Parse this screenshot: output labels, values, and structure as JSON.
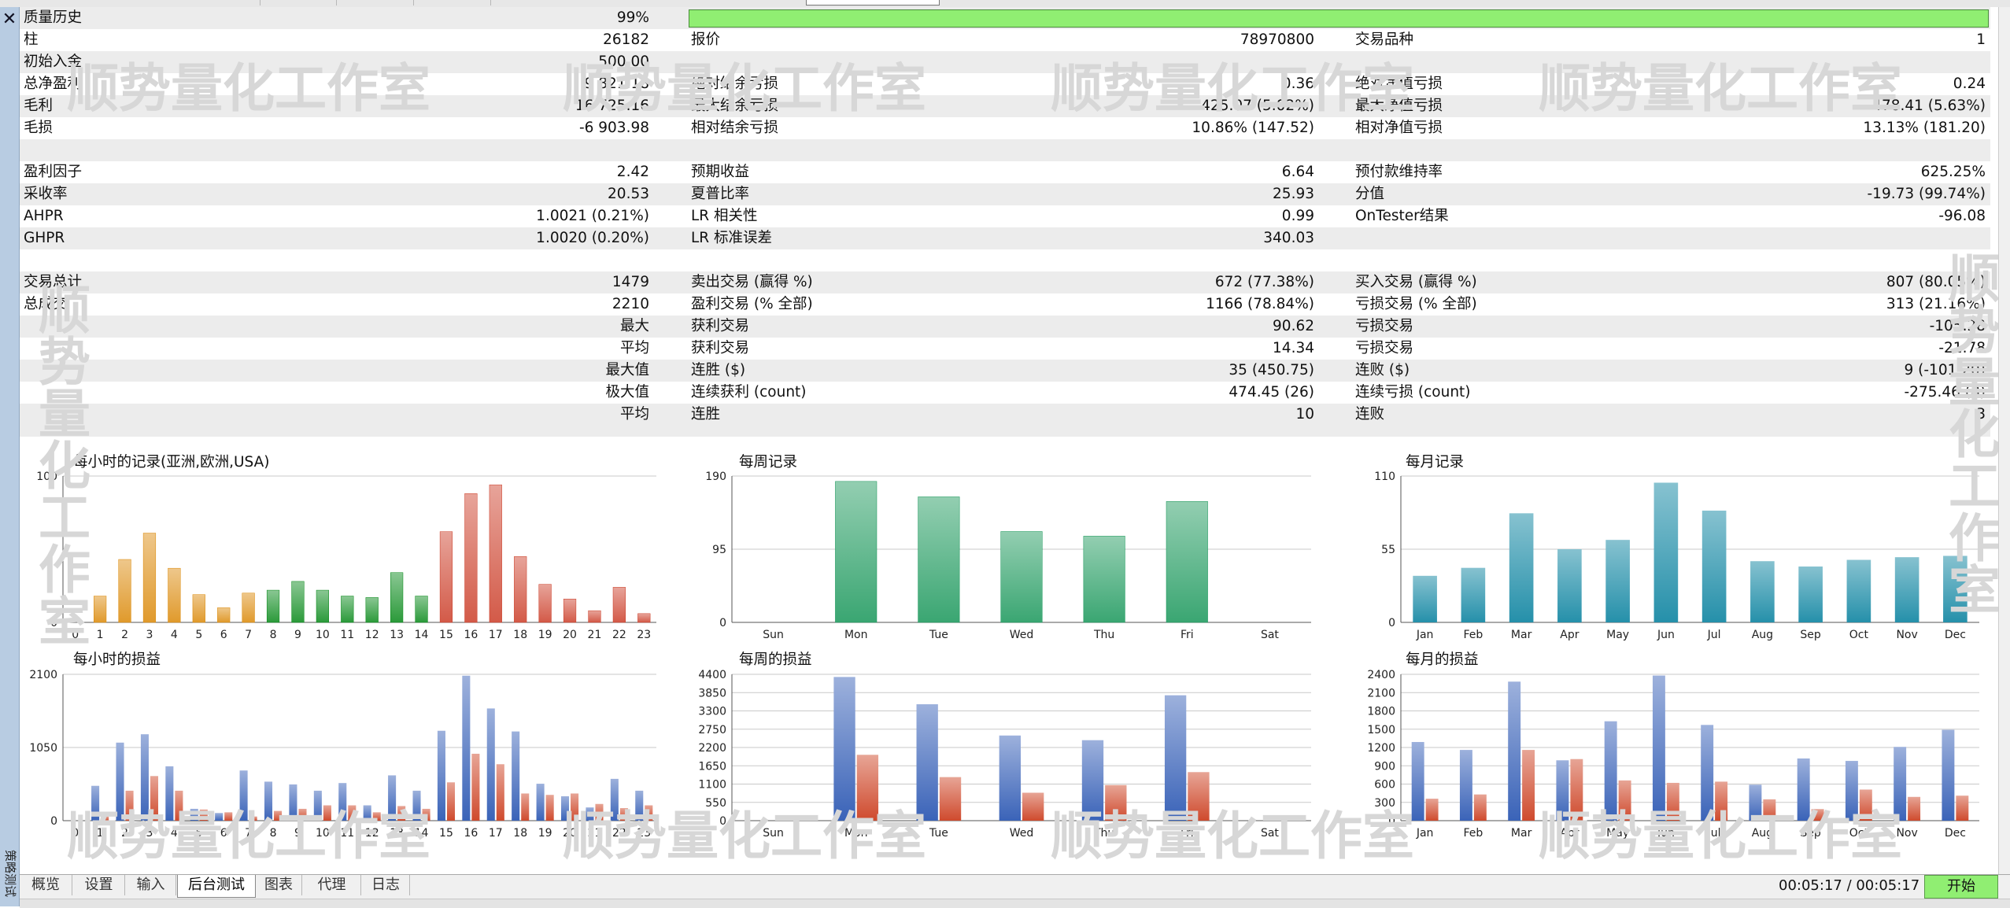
{
  "side_label": "策略测试",
  "stats": [
    {
      "l1": "质量历史",
      "v1": "99%",
      "bar": true
    },
    {
      "l1": "柱",
      "v1": "26182",
      "l2": "报价",
      "v2": "78970800",
      "l3": "交易品种",
      "v3": "1"
    },
    {
      "l1": "初始入金",
      "v1": "500.00"
    },
    {
      "l1": "总净盈利",
      "v1": "9 821.18",
      "l2": "绝对结余亏损",
      "v2": "0.36",
      "l3": "绝对净值亏损",
      "v3": "0.24"
    },
    {
      "l1": "毛利",
      "v1": "16 725.16",
      "l2": "最大结余亏损",
      "v2": "425.07 (5.02%)",
      "l3": "最大净值亏损",
      "v3": "478.41 (5.63%)"
    },
    {
      "l1": "毛损",
      "v1": "-6 903.98",
      "l2": "相对结余亏损",
      "v2": "10.86% (147.52)",
      "l3": "相对净值亏损",
      "v3": "13.13% (181.20)"
    },
    {
      "gap": true
    },
    {
      "l1": "盈利因子",
      "v1": "2.42",
      "l2": "预期收益",
      "v2": "6.64",
      "l3": "预付款维持率",
      "v3": "625.25%"
    },
    {
      "l1": "采收率",
      "v1": "20.53",
      "l2": "夏普比率",
      "v2": "25.93",
      "l3": "分值",
      "v3": "-19.73 (99.74%)"
    },
    {
      "l1": "AHPR",
      "v1": "1.0021 (0.21%)",
      "l2": "LR 相关性",
      "v2": "0.99",
      "l3": "OnTester结果",
      "v3": "-96.08"
    },
    {
      "l1": "GHPR",
      "v1": "1.0020 (0.20%)",
      "l2": "LR 标准误差",
      "v2": "340.03"
    },
    {
      "gap": true
    },
    {
      "l1": "交易总计",
      "v1": "1479",
      "l2": "卖出交易 (赢得 %)",
      "v2": "672 (77.38%)",
      "l3": "买入交易 (赢得 %)",
      "v3": "807 (80.05%)"
    },
    {
      "l1": "总成交",
      "v1": "2210",
      "l2": "盈利交易 (% 全部)",
      "v2": "1166 (78.84%)",
      "l3": "亏损交易 (% 全部)",
      "v3": "313 (21.16%)"
    },
    {
      "v1": "最大",
      "l2": "获利交易",
      "v2": "90.62",
      "l3": "亏损交易",
      "v3": "-105.28"
    },
    {
      "v1": "平均",
      "l2": "获利交易",
      "v2": "14.34",
      "l3": "亏损交易",
      "v3": "-21.78"
    },
    {
      "v1": "最大值",
      "l2": "连胜 ($)",
      "v2": "35 (450.75)",
      "l3": "连败 ($)",
      "v3": "9 (-101.20)"
    },
    {
      "v1": "极大值",
      "l2": "连续获利 (count)",
      "v2": "474.45 (26)",
      "l3": "连续亏损 (count)",
      "v3": "-275.46 (8)"
    },
    {
      "v1": "平均",
      "l2": "连胜",
      "v2": "10",
      "l3": "连败",
      "v3": "3"
    }
  ],
  "watermark": "顺势量化工作室",
  "chart_data": [
    {
      "type": "bar",
      "title": "每小时的记录(亚洲,欧洲,USA)",
      "categories": [
        "0",
        "1",
        "2",
        "3",
        "4",
        "5",
        "6",
        "7",
        "8",
        "9",
        "10",
        "11",
        "12",
        "13",
        "14",
        "15",
        "16",
        "17",
        "18",
        "19",
        "20",
        "21",
        "22",
        "23"
      ],
      "values": [
        0,
        18,
        43,
        61,
        37,
        19,
        10,
        20,
        22,
        28,
        22,
        18,
        17,
        34,
        18,
        62,
        88,
        94,
        45,
        26,
        16,
        8,
        24,
        6
      ],
      "ylim": [
        0,
        100
      ],
      "yticks": [
        "0",
        "100"
      ],
      "colors": [
        "#e09a2c",
        "#e09a2c",
        "#e09a2c",
        "#e09a2c",
        "#e09a2c",
        "#e09a2c",
        "#e09a2c",
        "#e09a2c",
        "#2b9a3a",
        "#2b9a3a",
        "#2b9a3a",
        "#2b9a3a",
        "#2b9a3a",
        "#2b9a3a",
        "#2b9a3a",
        "#d35a48",
        "#d35a48",
        "#d35a48",
        "#d35a48",
        "#d35a48",
        "#d35a48",
        "#d35a48",
        "#d35a48",
        "#d35a48"
      ]
    },
    {
      "type": "bar",
      "title": "每周记录",
      "categories": [
        "Sun",
        "Mon",
        "Tue",
        "Wed",
        "Thu",
        "Fri",
        "Sat"
      ],
      "values": [
        0,
        183,
        163,
        118,
        112,
        157,
        0
      ],
      "ylim": [
        0,
        190
      ],
      "yticks": [
        "0",
        "95",
        "190"
      ],
      "color": "#3aa672"
    },
    {
      "type": "bar",
      "title": "每月记录",
      "categories": [
        "Jan",
        "Feb",
        "Mar",
        "Apr",
        "May",
        "Jun",
        "Jul",
        "Aug",
        "Sep",
        "Oct",
        "Nov",
        "Dec"
      ],
      "values": [
        35,
        41,
        82,
        55,
        62,
        105,
        84,
        46,
        42,
        47,
        49,
        50
      ],
      "ylim": [
        0,
        110
      ],
      "yticks": [
        "0",
        "55",
        "110"
      ],
      "color": "#2590aa"
    },
    {
      "type": "bar",
      "title": "每小时的损益",
      "categories": [
        "0",
        "1",
        "2",
        "3",
        "4",
        "5",
        "6",
        "7",
        "8",
        "9",
        "10",
        "11",
        "12",
        "13",
        "14",
        "15",
        "16",
        "17",
        "18",
        "19",
        "20",
        "21",
        "22",
        "23"
      ],
      "series": [
        {
          "values": [
            0,
            500,
            1120,
            1240,
            780,
            170,
            110,
            720,
            560,
            520,
            430,
            540,
            220,
            650,
            430,
            1290,
            2080,
            1610,
            1280,
            530,
            350,
            190,
            600,
            430
          ]
        },
        {
          "values": [
            0,
            60,
            430,
            640,
            430,
            160,
            120,
            60,
            140,
            170,
            220,
            220,
            120,
            210,
            170,
            550,
            960,
            810,
            390,
            370,
            390,
            240,
            180,
            220
          ]
        }
      ],
      "ylim": [
        0,
        2100
      ],
      "yticks": [
        "0",
        "1050",
        "2100"
      ],
      "colors": [
        "#3a63b8",
        "#cf4a2d"
      ]
    },
    {
      "type": "bar",
      "title": "每周的损益",
      "categories": [
        "Sun",
        "Mon",
        "Tue",
        "Wed",
        "Thu",
        "Fri",
        "Sat"
      ],
      "series": [
        {
          "values": [
            0,
            4320,
            3500,
            2560,
            2420,
            3770,
            0
          ]
        },
        {
          "values": [
            0,
            1980,
            1310,
            840,
            1070,
            1460,
            0
          ]
        }
      ],
      "ylim": [
        0,
        4400
      ],
      "yticks": [
        "0",
        "550",
        "1100",
        "1650",
        "2200",
        "2750",
        "3300",
        "3850",
        "4400"
      ],
      "colors": [
        "#3a63b8",
        "#cf4a2d"
      ]
    },
    {
      "type": "bar",
      "title": "每月的损益",
      "categories": [
        "Jan",
        "Feb",
        "Mar",
        "Apr",
        "May",
        "Jun",
        "Jul",
        "Aug",
        "Sep",
        "Oct",
        "Nov",
        "Dec"
      ],
      "series": [
        {
          "values": [
            1290,
            1160,
            2280,
            990,
            1630,
            2380,
            1570,
            590,
            1020,
            980,
            1210,
            1490
          ]
        },
        {
          "values": [
            360,
            430,
            1160,
            1010,
            660,
            620,
            640,
            350,
            190,
            510,
            390,
            410
          ]
        }
      ],
      "ylim": [
        0,
        2400
      ],
      "yticks": [
        "0",
        "300",
        "600",
        "900",
        "1200",
        "1500",
        "1800",
        "2100",
        "2400"
      ],
      "colors": [
        "#3a63b8",
        "#cf4a2d"
      ]
    }
  ],
  "bottom_tabs": [
    "概览",
    "设置",
    "输入",
    "后台测试",
    "图表",
    "代理",
    "日志"
  ],
  "active_tab": "后台测试",
  "timer": "00:05:17 / 00:05:17",
  "start_button": "开始"
}
